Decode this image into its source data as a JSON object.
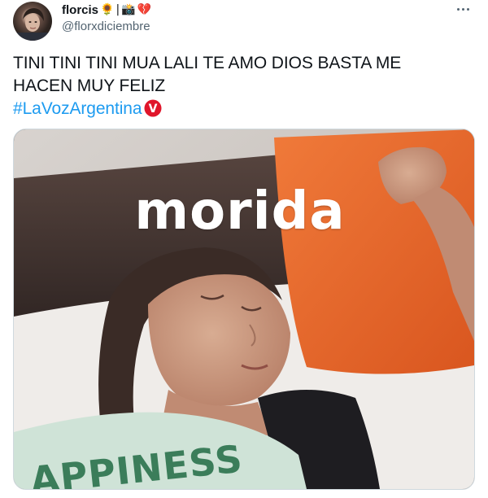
{
  "author": {
    "display_name": "florcis",
    "handle": "@florxdiciembre",
    "name_emojis": [
      "🌻",
      "|",
      "📸",
      "💔"
    ]
  },
  "menu": {
    "more_icon": "more-horizontal-icon"
  },
  "tweet": {
    "text_lines": [
      "TINI TINI TINI MUA LALI TE AMO DIOS BASTA ME",
      "HACEN MUY FELIZ"
    ],
    "hashtag": "#LaVozArgentina",
    "hashflag_letter": "V"
  },
  "media": {
    "caption": "morida",
    "shirt_text": "APPINESS"
  },
  "colors": {
    "link": "#1d9bf0",
    "text": "#0f1419",
    "secondary": "#536471",
    "hashflag_red": "#e0162b",
    "pillow_orange": "#e8672a"
  }
}
